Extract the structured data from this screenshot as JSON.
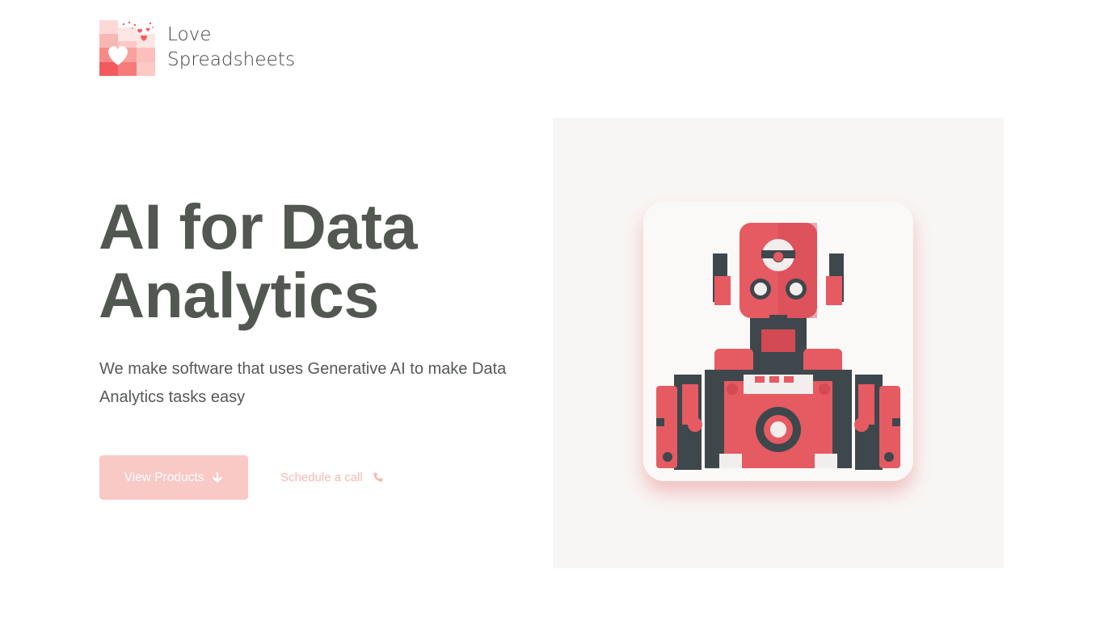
{
  "brand": {
    "line1": "Love",
    "line2": "Spreadsheets",
    "logo_icon": "heart-spreadsheet-icon",
    "accent_color": "#f25a5e"
  },
  "hero": {
    "title": "AI for Data Analytics",
    "subtitle": "We make software that uses Generative AI to make Data Analytics tasks easy",
    "image_icon": "robot-icon"
  },
  "actions": {
    "primary_label": "View Products",
    "primary_icon": "arrow-down-icon",
    "secondary_label": "Schedule a call",
    "secondary_icon": "phone-icon"
  },
  "colors": {
    "primary_button_bg": "#f8c9c5",
    "secondary_link": "#f7b9b3",
    "heading": "#525752"
  }
}
